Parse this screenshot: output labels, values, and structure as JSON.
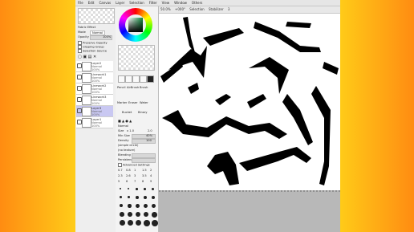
{
  "menu": [
    "File",
    "Edit",
    "Canvas",
    "Layer",
    "Selection",
    "Filter",
    "View",
    "Window",
    "Others"
  ],
  "canvas_toolbar": {
    "zoom": "50.0%",
    "angle": "+000°",
    "selection_label": "Selection",
    "stabilizer_label": "Stabilizer",
    "stabilizer_value": "3"
  },
  "left_panel": {
    "paper_effect": "Fabric Effect",
    "mode_label": "Mode",
    "mode_value": "Normal",
    "opacity_label": "Opacity",
    "opacity_value": "100%",
    "options": [
      "Preserve Opacity",
      "Clipping Group",
      "Selection Source"
    ],
    "layers": [
      {
        "name": "Layer2",
        "mode": "Normal",
        "pct": "100%",
        "selected": false
      },
      {
        "name": "Linework1",
        "mode": "Normal",
        "pct": "100%",
        "selected": false
      },
      {
        "name": "Linework2",
        "mode": "Normal",
        "pct": "100%",
        "selected": false
      },
      {
        "name": "Linework3",
        "mode": "Normal",
        "pct": "100%",
        "selected": false
      },
      {
        "name": "Layer3",
        "mode": "Normal",
        "pct": "100%",
        "selected": true
      },
      {
        "name": "Layer1",
        "mode": "Normal",
        "pct": "100%",
        "selected": false
      }
    ]
  },
  "tool_panel": {
    "tools": [
      "Pencil",
      "AirBrush",
      "Brush",
      "Water",
      "Marker",
      "Eraser",
      "SelPen",
      "SelErase",
      "Bucket",
      "Binary"
    ],
    "settings": {
      "normal": "Normal",
      "size_label": "Size",
      "size_mult": "x 1.0",
      "size_value": "2.0",
      "min_size_label": "Min Size",
      "min_size_value": "40%",
      "density_label": "Density",
      "density_value": "100",
      "shape_label": "(simple circle)",
      "texture_label": "(no texture)",
      "blending_label": "Blending",
      "persistence_label": "Persistence",
      "advanced": "Advanced Settings"
    },
    "size_presets": [
      "0.7",
      "0.8",
      "1",
      "1.5",
      "2",
      "2.3",
      "2.6",
      "3",
      "3.5",
      "4",
      "5",
      "6",
      "7",
      "8",
      "9"
    ]
  },
  "colors": {
    "accent": "#c9c8f2",
    "green": "#0c8b3c"
  }
}
